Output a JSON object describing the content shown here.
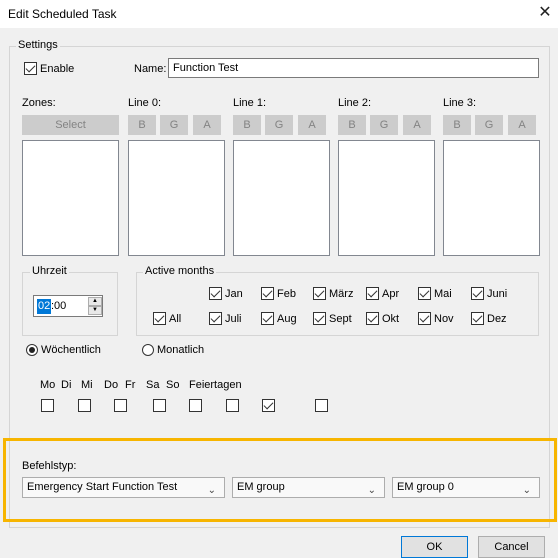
{
  "window": {
    "title": "Edit Scheduled Task",
    "close_glyph": "✕"
  },
  "settings": {
    "group_label": "Settings",
    "enable_label": "Enable",
    "enable_checked": true,
    "name_label": "Name:",
    "name_value": "Function Test"
  },
  "zones": {
    "label": "Zones:",
    "select_button": "Select",
    "lines": [
      {
        "label": "Line 0:",
        "b": "B",
        "g": "G",
        "a": "A"
      },
      {
        "label": "Line 1:",
        "b": "B",
        "g": "G",
        "a": "A"
      },
      {
        "label": "Line 2:",
        "b": "B",
        "g": "G",
        "a": "A"
      },
      {
        "label": "Line 3:",
        "b": "B",
        "g": "G",
        "a": "A"
      }
    ]
  },
  "uhrzeit": {
    "label": "Uhrzeit",
    "hour": "02",
    "rest": ":00"
  },
  "months": {
    "label": "Active months",
    "all_label": "All",
    "items": [
      {
        "label": "Jan",
        "checked": true
      },
      {
        "label": "Feb",
        "checked": true
      },
      {
        "label": "März",
        "checked": true
      },
      {
        "label": "Apr",
        "checked": true
      },
      {
        "label": "Mai",
        "checked": true
      },
      {
        "label": "Juni",
        "checked": true
      },
      {
        "label": "Juli",
        "checked": true
      },
      {
        "label": "Aug",
        "checked": true
      },
      {
        "label": "Sept",
        "checked": true
      },
      {
        "label": "Okt",
        "checked": true
      },
      {
        "label": "Nov",
        "checked": true
      },
      {
        "label": "Dez",
        "checked": true
      }
    ]
  },
  "schedule": {
    "weekly_label": "Wöchentlich",
    "monthly_label": "Monatlich",
    "weekly_selected": true
  },
  "days": {
    "items": [
      {
        "label": "Mo",
        "checked": false
      },
      {
        "label": "Di",
        "checked": false
      },
      {
        "label": "Mi",
        "checked": false
      },
      {
        "label": "Do",
        "checked": false
      },
      {
        "label": "Fr",
        "checked": false
      },
      {
        "label": "Sa",
        "checked": false
      },
      {
        "label": "So",
        "checked": true
      }
    ],
    "holiday_label": "Feiertagen",
    "holiday_checked": false
  },
  "command": {
    "label": "Befehlstyp:",
    "type_value": "Emergency Start Function Test",
    "group_value": "EM group",
    "group_num_value": "EM group 0"
  },
  "footer": {
    "ok_label": "OK",
    "cancel_label": "Cancel"
  },
  "colors": {
    "highlight": "#f7b500"
  }
}
